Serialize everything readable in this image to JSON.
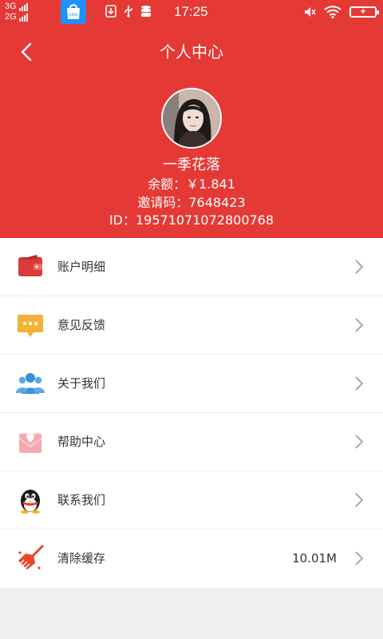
{
  "status_bar": {
    "net_top": "3G",
    "net_bottom": "2G",
    "time": "17:25",
    "battery_symbol": "+",
    "icons": [
      "app-store-icon",
      "download-icon",
      "usb-icon",
      "storage-icon",
      "mute-icon",
      "wifi-icon",
      "battery-icon"
    ]
  },
  "header": {
    "title": "个人中心",
    "back_icon": "chevron-left-icon",
    "background": "#e53935"
  },
  "profile": {
    "nickname": "一季花落",
    "balance": "余额：￥1.841",
    "invite_code": "邀请码：7648423",
    "user_id": "ID：19571071072800768"
  },
  "menu": [
    {
      "label": "账户明细",
      "icon": "wallet-icon",
      "value": ""
    },
    {
      "label": "意见反馈",
      "icon": "feedback-icon",
      "value": ""
    },
    {
      "label": "关于我们",
      "icon": "group-icon",
      "value": ""
    },
    {
      "label": "帮助中心",
      "icon": "help-envelope-icon",
      "value": ""
    },
    {
      "label": "联系我们",
      "icon": "qq-penguin-icon",
      "value": ""
    },
    {
      "label": "清除缓存",
      "icon": "broom-icon",
      "value": "10.01M"
    }
  ],
  "colors": {
    "accent": "#e53935",
    "wallet": "#d93a3a",
    "feedback": "#f2b233",
    "group": "#3a8fd8",
    "help": "#f4a9b0",
    "broom": "#e8452c"
  }
}
